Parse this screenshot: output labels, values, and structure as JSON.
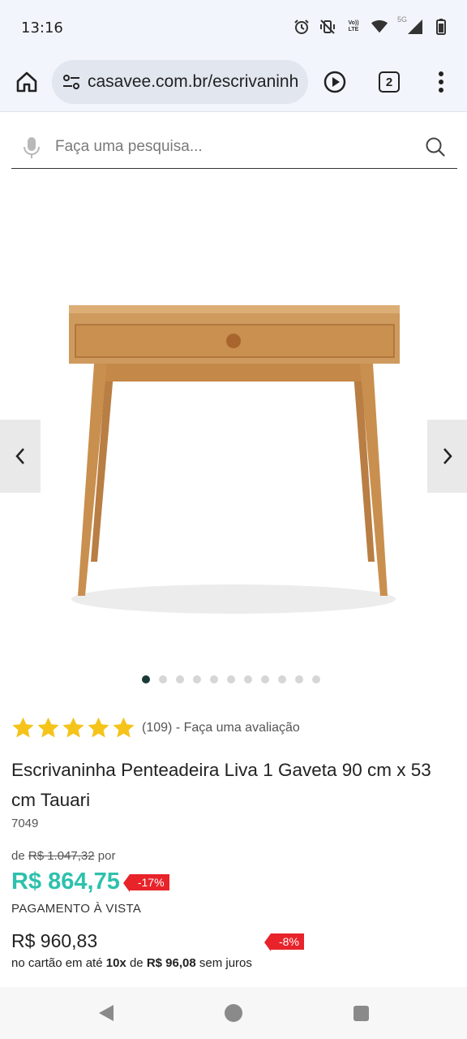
{
  "status_bar": {
    "time": "13:16",
    "icons": [
      "alarm-icon",
      "vibrate-off-icon",
      "volte-icon",
      "wifi-icon",
      "signal-5g-icon",
      "battery-icon"
    ],
    "volte_top": "Vo))",
    "volte_bottom": "LTE",
    "network": "5G"
  },
  "browser": {
    "url": "casavee.com.br/escrivaninh",
    "tab_count": "2"
  },
  "search": {
    "placeholder": "Faça uma pesquisa..."
  },
  "carousel": {
    "total_slides": 11,
    "active_index": 0
  },
  "product": {
    "rating_stars": 5,
    "reviews": "(109)",
    "separator": "-",
    "review_cta": "Faça uma avaliação",
    "title": "Escrivaninha Penteadeira Liva 1 Gaveta 90 cm x 53 cm Tauari",
    "sku": "7049",
    "old_price_prefix": "de",
    "old_price": "R$ 1.047,32",
    "old_price_suffix": "por",
    "cash_price": "R$ 864,75",
    "cash_discount": "-17%",
    "cash_label": "PAGAMENTO À VISTA",
    "card_price": "R$ 960,83",
    "card_discount": "-8%",
    "installment_prefix": "no cartão em até",
    "installment_count": "10x",
    "installment_de": "de",
    "installment_value": "R$ 96,08",
    "installment_suffix": "sem juros"
  },
  "colors": {
    "accent": "#2ec1ac",
    "discount": "#e8232a",
    "star": "#f5c31a",
    "wood": "#c98f4e"
  }
}
